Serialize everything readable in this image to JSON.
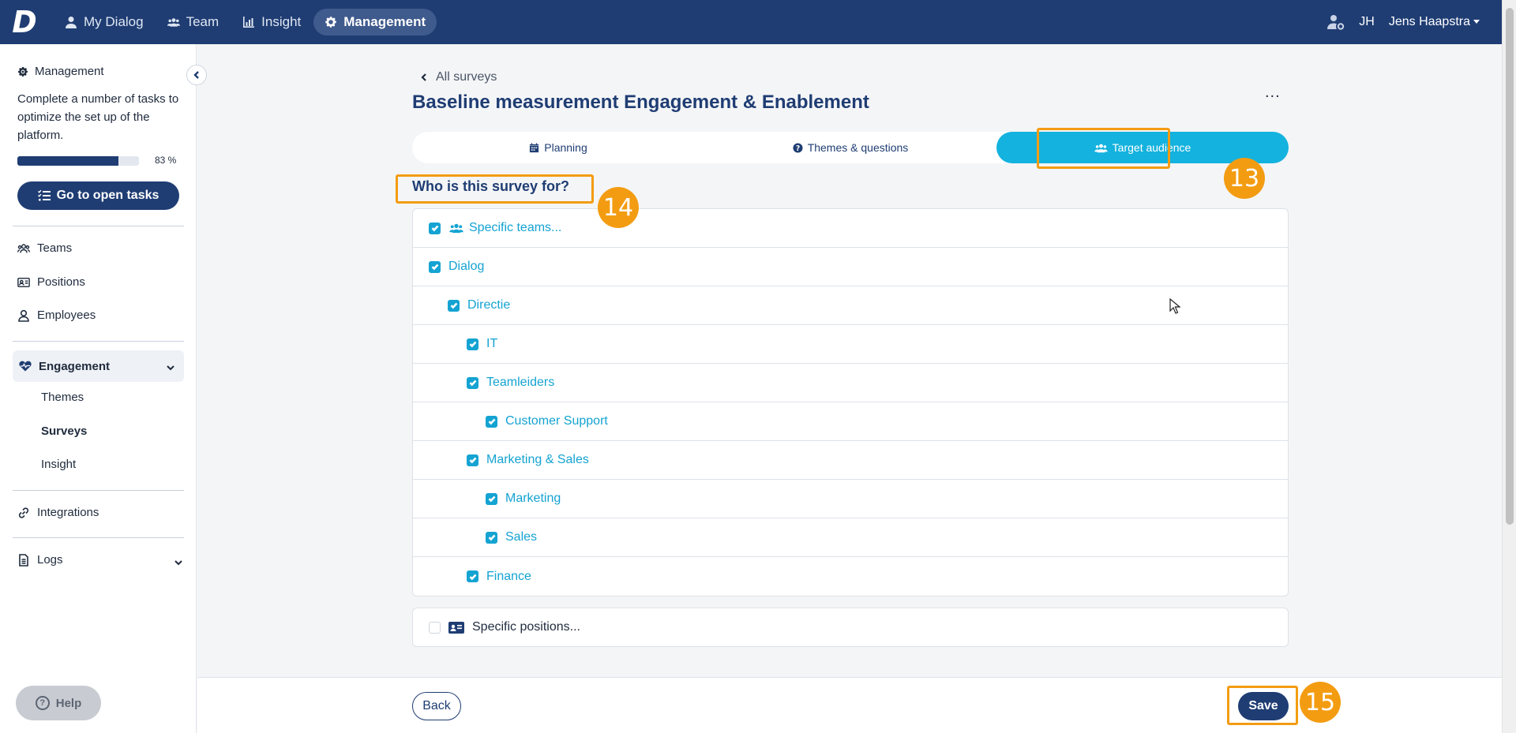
{
  "topnav": {
    "logo": "D",
    "items": [
      {
        "label": "My Dialog",
        "icon": "user-icon"
      },
      {
        "label": "Team",
        "icon": "users-icon"
      },
      {
        "label": "Insight",
        "icon": "chart-icon"
      },
      {
        "label": "Management",
        "icon": "gear-icon",
        "active": true
      }
    ],
    "user_initials": "JH",
    "user_name": "Jens Haapstra"
  },
  "sidebar": {
    "heading": "Management",
    "description": "Complete a number of tasks to optimize the set up of the platform.",
    "progress_percent": 83,
    "progress_label": "83 %",
    "tasks_button": "Go to open tasks",
    "items": [
      {
        "label": "Teams",
        "icon": "teams-icon"
      },
      {
        "label": "Positions",
        "icon": "id-card-icon"
      },
      {
        "label": "Employees",
        "icon": "person-icon"
      }
    ],
    "engagement": {
      "label": "Engagement",
      "subitems": [
        "Themes",
        "Surveys",
        "Insight"
      ]
    },
    "integrations": "Integrations",
    "logs": "Logs",
    "help": "Help"
  },
  "main": {
    "back_link": "All surveys",
    "title": "Baseline measurement Engagement & Enablement",
    "more": "...",
    "tabs": [
      {
        "label": "Planning",
        "icon": "calendar-icon"
      },
      {
        "label": "Themes & questions",
        "icon": "question-circle-icon"
      },
      {
        "label": "Target audience",
        "icon": "users-icon",
        "active": true
      }
    ],
    "question": "Who is this survey for?",
    "tree": [
      {
        "label": "Specific teams...",
        "level": 0,
        "checked": true,
        "icon": "users-icon"
      },
      {
        "label": "Dialog",
        "level": 0,
        "checked": true
      },
      {
        "label": "Directie",
        "level": 1,
        "checked": true
      },
      {
        "label": "IT",
        "level": 2,
        "checked": true
      },
      {
        "label": "Teamleiders",
        "level": 2,
        "checked": true
      },
      {
        "label": "Customer Support",
        "level": 3,
        "checked": true
      },
      {
        "label": "Marketing & Sales",
        "level": 2,
        "checked": true
      },
      {
        "label": "Marketing",
        "level": 3,
        "checked": true
      },
      {
        "label": "Sales",
        "level": 3,
        "checked": true
      },
      {
        "label": "Finance",
        "level": 2,
        "checked": true
      }
    ],
    "positions_label": "Specific positions...",
    "back_button": "Back",
    "save_button": "Save"
  },
  "annotations": {
    "b13": "13",
    "b14": "14",
    "b15": "15",
    "color": "#f39c12"
  },
  "colors": {
    "primary": "#1f3d73",
    "accent": "#14b2de",
    "link": "#14a3d2"
  }
}
